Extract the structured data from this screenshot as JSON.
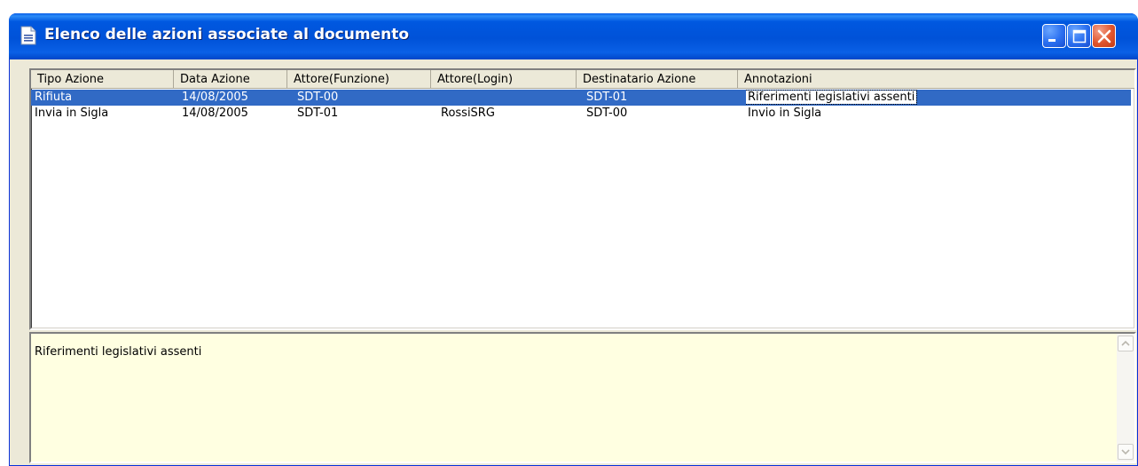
{
  "window": {
    "title": "Elenco delle azioni associate al documento",
    "icons": {
      "app": "document-list-icon",
      "minimize": "minimize-icon",
      "maximize": "maximize-icon",
      "close": "close-icon"
    },
    "colors": {
      "titlebar": "#0054e3",
      "close_button": "#e0552e",
      "selection": "#316ac5",
      "memo_background": "#ffffe1",
      "face": "#ece9d8"
    }
  },
  "table": {
    "columns": [
      "Tipo Azione",
      "Data Azione",
      "Attore(Funzione)",
      "Attore(Login)",
      "Destinatario Azione",
      "Annotazioni"
    ],
    "rows": [
      {
        "tipo": "Rifiuta",
        "data": "14/08/2005",
        "funzione": "SDT-00",
        "login": "",
        "destinatario": "SDT-01",
        "annotazioni": "Riferimenti legislativi assenti",
        "selected": true
      },
      {
        "tipo": "Invia in Sigla",
        "data": "14/08/2005",
        "funzione": "SDT-01",
        "login": "RossiSRG",
        "destinatario": "SDT-00",
        "annotazioni": "Invio in Sigla",
        "selected": false
      }
    ]
  },
  "memo": {
    "text": "Riferimenti legislativi assenti",
    "icons": {
      "scroll_up": "scroll-up-icon",
      "scroll_down": "scroll-down-icon"
    }
  }
}
